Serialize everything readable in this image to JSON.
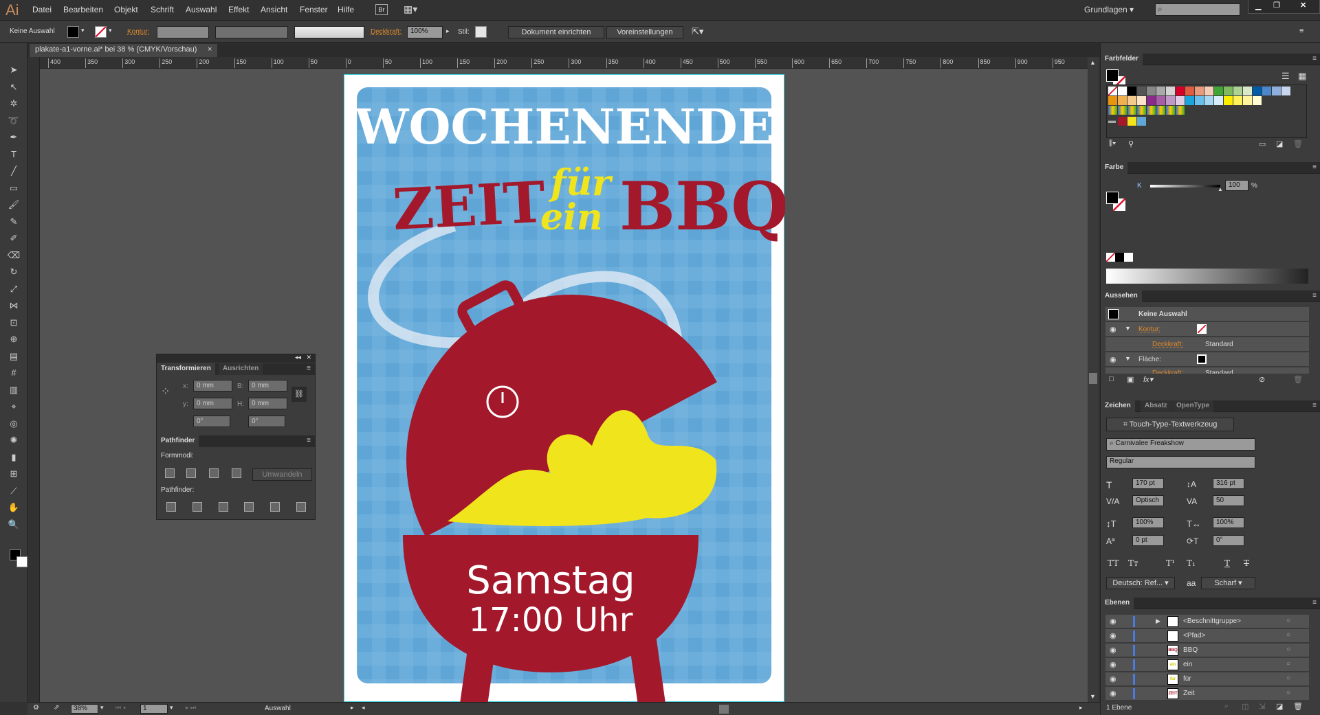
{
  "app": {
    "logo": "Ai",
    "menu": [
      "Datei",
      "Bearbeiten",
      "Objekt",
      "Schrift",
      "Auswahl",
      "Effekt",
      "Ansicht",
      "Fenster",
      "Hilfe"
    ],
    "bridge": "Br",
    "workspace": "Grundlagen",
    "search_placeholder": ""
  },
  "control": {
    "selection": "Keine Auswahl",
    "stroke_label": "Kontur:",
    "opacity_label": "Deckkraft:",
    "opacity": "100%",
    "style_label": "Stil:",
    "doc_setup": "Dokument einrichten",
    "preferences": "Voreinstellungen"
  },
  "document": {
    "tab": "plakate-a1-vorne.ai* bei 38 % (CMYK/Vorschau)",
    "ruler_h": [
      "400",
      "350",
      "300",
      "250",
      "200",
      "150",
      "100",
      "50",
      "0",
      "50",
      "100",
      "150",
      "200",
      "250",
      "300",
      "350",
      "400",
      "450",
      "500",
      "550",
      "600",
      "650",
      "700",
      "750",
      "800",
      "850",
      "900",
      "950"
    ],
    "poster": {
      "line1": "WOCHENENDE",
      "zeit": "ZEIT",
      "fuer": "für",
      "ein": "ein",
      "bbq": "BBQ",
      "day": "Samstag",
      "time": "17:00 Uhr",
      "colors": {
        "blue": "#5fa6d6",
        "red": "#a3182a",
        "yellow": "#f0e51c",
        "white": "#ffffff"
      }
    }
  },
  "status": {
    "zoom": "38%",
    "page": "1",
    "tool": "Auswahl"
  },
  "transform": {
    "tabs": [
      "Transformieren",
      "Ausrichten"
    ],
    "x_label": "x:",
    "x": "0 mm",
    "y_label": "y:",
    "y": "0 mm",
    "w_label": "B:",
    "w": "0 mm",
    "h_label": "H:",
    "h": "0 mm",
    "angle": "0°",
    "shear": "0°"
  },
  "pathfinder": {
    "title": "Pathfinder",
    "shape_modes": "Formmodi:",
    "expand": "Umwandeln",
    "pathfinders": "Pathfinder:"
  },
  "swatches": {
    "title": "Farbfelder",
    "colors": [
      "#ffffff",
      "#ffffff",
      "#000000",
      "#555555",
      "#888888",
      "#aaaaaa",
      "#d4d4d4",
      "#d4002a",
      "#e05c40",
      "#e99a7a",
      "#f4cdb8",
      "#3fa535",
      "#7fba5e",
      "#acd294",
      "#d7e9c9",
      "#005ca9",
      "#4b88cb",
      "#8fb0dd",
      "#c7d5ef",
      "#e8940d",
      "#f0b050",
      "#f5cb8d",
      "#fae3c7",
      "#8a2a8c",
      "#a65fa6",
      "#c197c7",
      "#e0cde3",
      "#1aa5df",
      "#69c0ec",
      "#a6d7f3",
      "#d6ecf9",
      "#ffed00",
      "#fff159",
      "#fff59c",
      "#fffbd3"
    ],
    "doc_colors": [
      "#a3182a",
      "#f0e51c",
      "#5fa6d6"
    ]
  },
  "color": {
    "title": "Farbe",
    "channel": "K",
    "value": "100",
    "unit": "%"
  },
  "appearance": {
    "title": "Aussehen",
    "selection": "Keine Auswahl",
    "stroke": "Kontur:",
    "opacity": "Deckkraft:",
    "standard": "Standard",
    "fill": "Fläche:",
    "fx": "fx"
  },
  "character": {
    "tabs": [
      "Zeichen",
      "Absatz",
      "OpenType"
    ],
    "touch_type": "Touch-Type-Textwerkzeug",
    "font": "Carnivalee Freakshow",
    "style": "Regular",
    "size": "170 pt",
    "leading": "316 pt",
    "kerning": "Optisch",
    "tracking": "50",
    "vscale": "100%",
    "hscale": "100%",
    "baseline": "0 pt",
    "rotation": "0°",
    "language": "Deutsch: Ref...",
    "antialias": "Scharf",
    "aa": "aa"
  },
  "layers": {
    "title": "Ebenen",
    "items": [
      {
        "name": "<Beschnittgruppe>",
        "expand": "▶",
        "thumb": ""
      },
      {
        "name": "<Pfad>",
        "thumb": ""
      },
      {
        "name": "BBQ",
        "thumb": "BBQ"
      },
      {
        "name": "ein",
        "thumb": "ein"
      },
      {
        "name": "für",
        "thumb": "für"
      },
      {
        "name": "Zeit",
        "thumb": "ZEIT"
      }
    ],
    "count": "1 Ebene"
  }
}
